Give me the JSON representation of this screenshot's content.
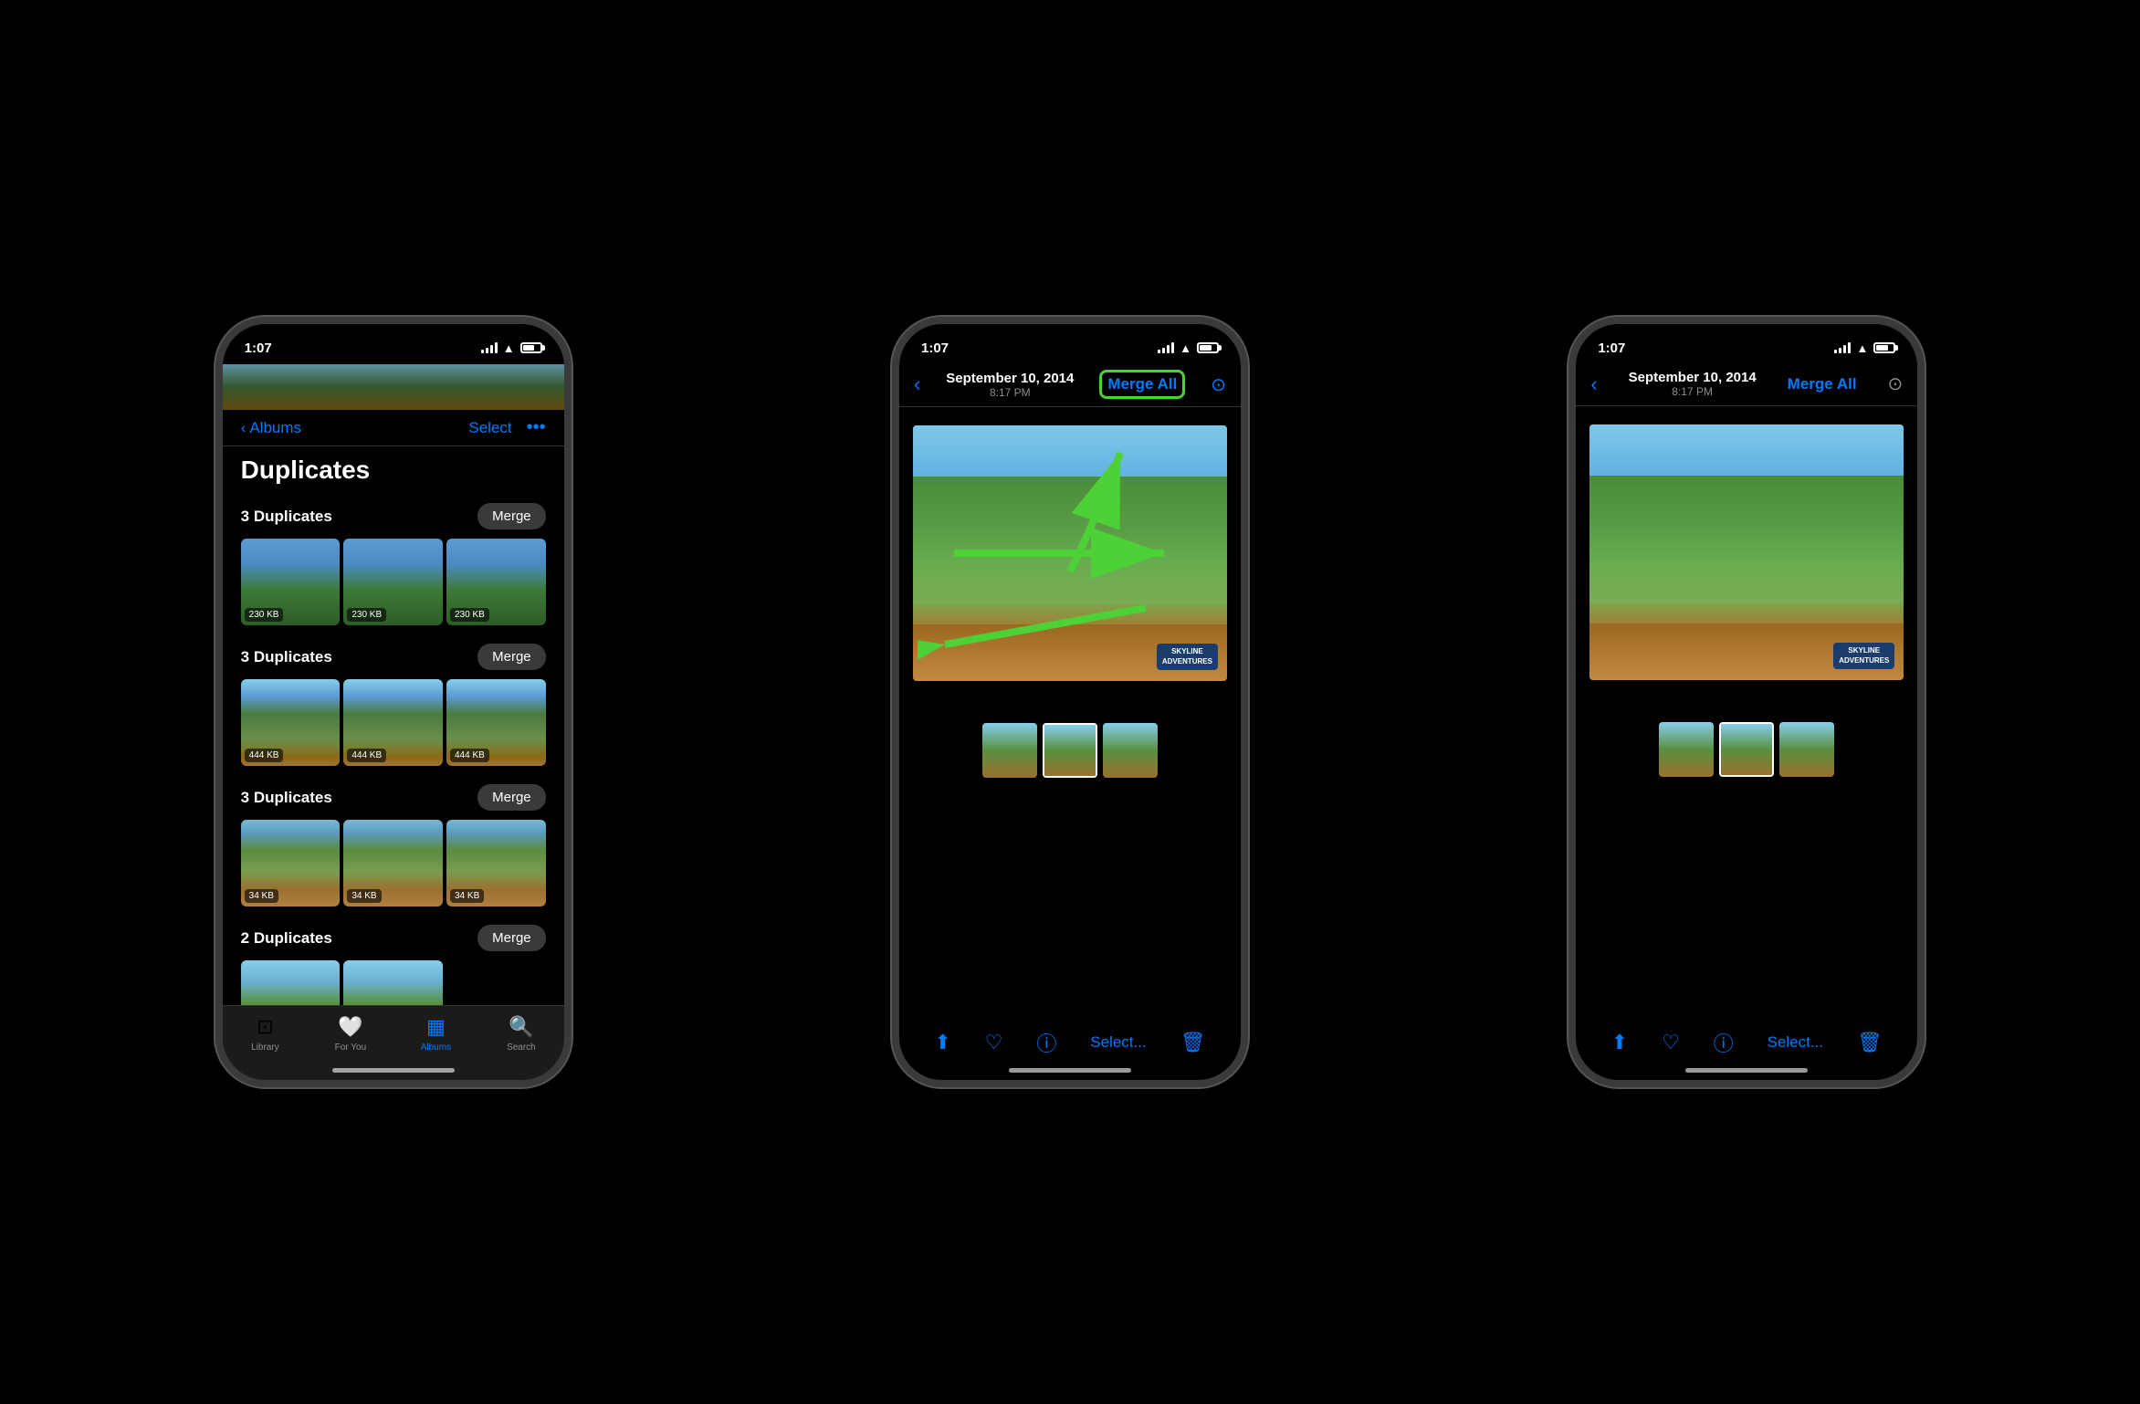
{
  "background": "#000000",
  "phones": [
    {
      "id": "phone1",
      "type": "duplicates-list",
      "statusBar": {
        "time": "1:07",
        "signal": true,
        "wifi": true,
        "battery": true
      },
      "navBack": "Albums",
      "navTitle": "Duplicates",
      "navSelect": "Select",
      "navMore": "...",
      "groups": [
        {
          "title": "3 Duplicates",
          "mergeLabel": "Merge",
          "photos": [
            {
              "size": "230 KB",
              "type": "mountain"
            },
            {
              "size": "230 KB",
              "type": "mountain"
            },
            {
              "size": "230 KB",
              "type": "mountain"
            }
          ]
        },
        {
          "title": "3 Duplicates",
          "mergeLabel": "Merge",
          "highlighted": true,
          "photos": [
            {
              "size": "444 KB",
              "type": "zipline"
            },
            {
              "size": "444 KB",
              "type": "zipline",
              "highlight": true
            },
            {
              "size": "444 KB",
              "type": "zipline"
            }
          ]
        },
        {
          "title": "3 Duplicates",
          "mergeLabel": "Merge",
          "photos": [
            {
              "size": "34 KB",
              "type": "zipline2"
            },
            {
              "size": "34 KB",
              "type": "zipline2"
            },
            {
              "size": "34 KB",
              "type": "zipline2"
            }
          ]
        },
        {
          "title": "2 Duplicates",
          "mergeLabel": "Merge",
          "photos": [
            {
              "size": "",
              "type": "group"
            },
            {
              "size": "",
              "type": "group"
            }
          ]
        }
      ],
      "tabBar": {
        "items": [
          {
            "label": "Library",
            "icon": "📷",
            "active": false
          },
          {
            "label": "For You",
            "icon": "❤️",
            "active": false
          },
          {
            "label": "Albums",
            "icon": "▦",
            "active": true
          },
          {
            "label": "Search",
            "icon": "🔍",
            "active": false
          }
        ]
      }
    },
    {
      "id": "phone2",
      "type": "detail-with-arrows",
      "statusBar": {
        "time": "1:07"
      },
      "navDate": "September 10, 2014",
      "navTime": "8:17 PM",
      "mergeAllLabel": "Merge All",
      "mergeAllHighlighted": true,
      "mainPhoto": "zipline",
      "thumbnailCount": 3,
      "showArrows": true,
      "toolbar": {
        "share": "↑",
        "heart": "♡",
        "info": "ⓘ",
        "select": "Select...",
        "trash": "🗑"
      }
    },
    {
      "id": "phone3",
      "type": "detail-no-arrows",
      "statusBar": {
        "time": "1:07"
      },
      "navDate": "September 10, 2014",
      "navTime": "8:17 PM",
      "mergeAllLabel": "Merge All",
      "mainPhoto": "zipline",
      "thumbnailCount": 3,
      "showArrows": false,
      "toolbar": {
        "share": "↑",
        "heart": "♡",
        "info": "ⓘ",
        "select": "Select...",
        "trash": "🗑"
      }
    }
  ]
}
